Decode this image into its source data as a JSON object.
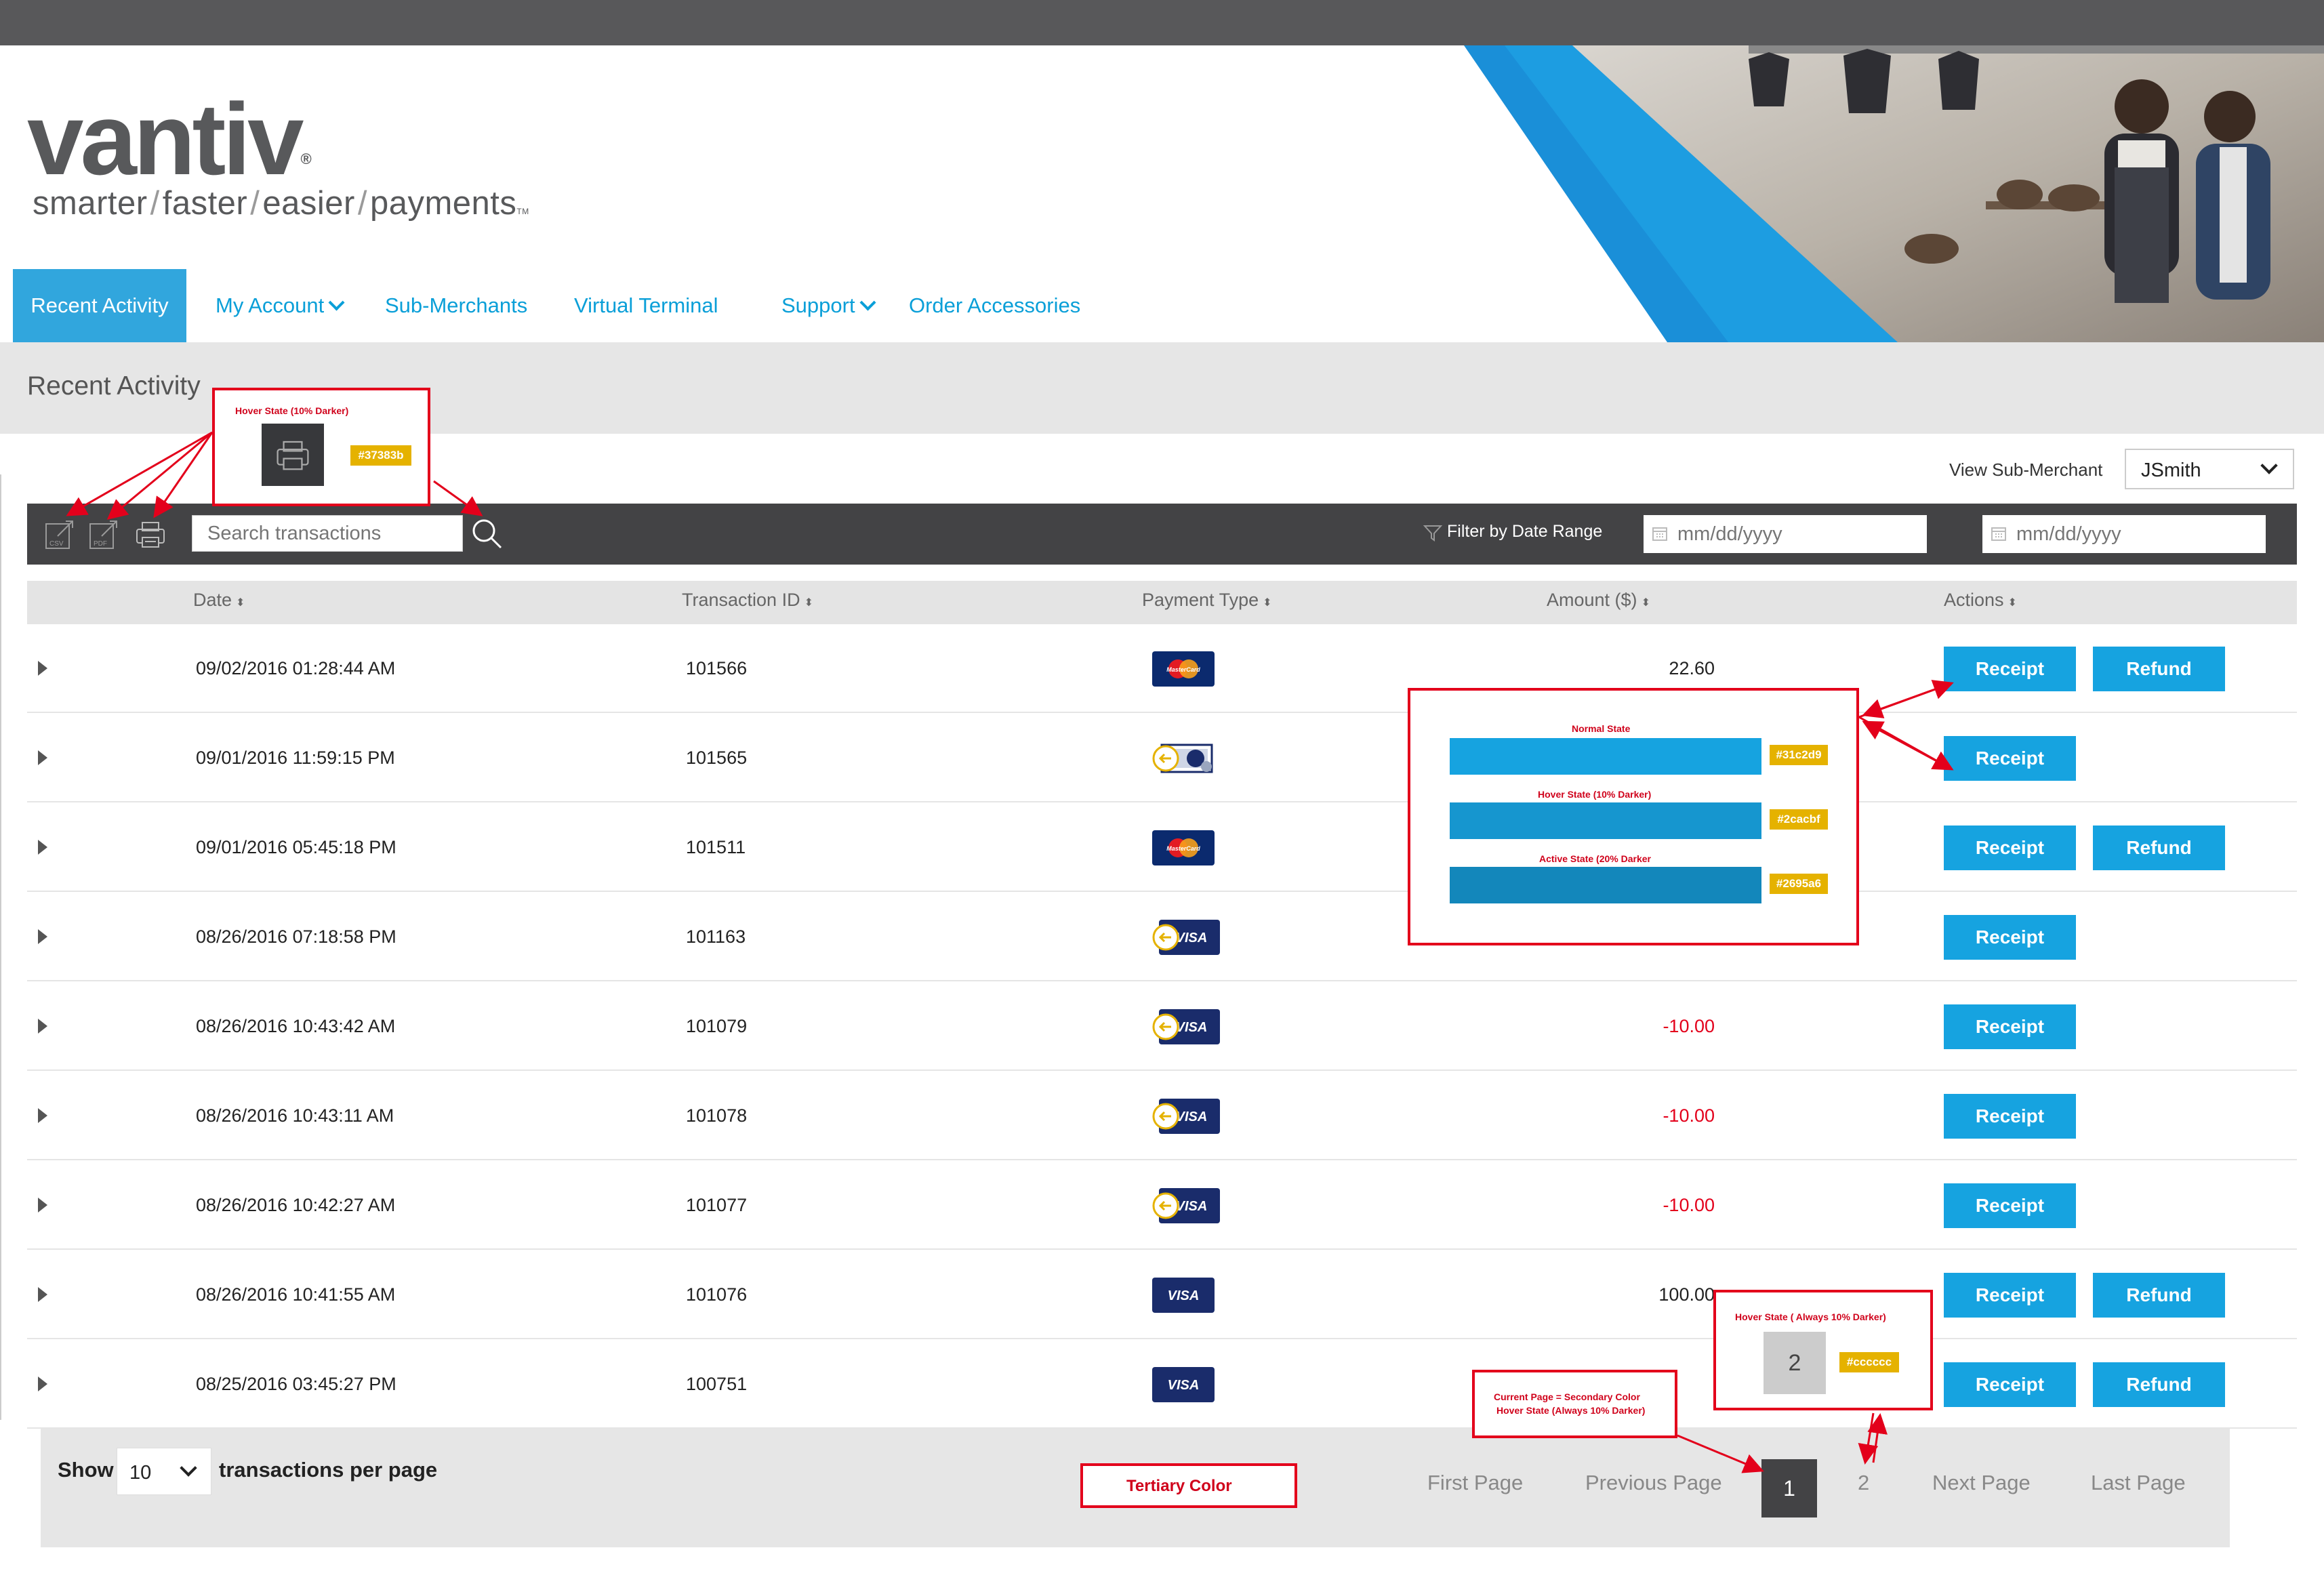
{
  "brand": {
    "logo": "vantiv",
    "tagline_parts": [
      "smarter",
      "faster",
      "easier",
      "payments"
    ],
    "tagline_separator": "/",
    "tm": "TM"
  },
  "nav": {
    "items": [
      {
        "label": "Recent Activity",
        "active": true
      },
      {
        "label": "My Account",
        "dropdown": true
      },
      {
        "label": "Sub-Merchants"
      },
      {
        "label": "Virtual Terminal"
      },
      {
        "label": "Support",
        "dropdown": true
      },
      {
        "label": "Order Accessories"
      }
    ]
  },
  "page": {
    "title": "Recent Activity"
  },
  "sub_merchant": {
    "label": "View Sub-Merchant",
    "value": "JSmith"
  },
  "toolbar": {
    "export_icons": [
      "csv-icon",
      "pdf-icon",
      "print-icon"
    ],
    "csv_label": "CSV",
    "pdf_label": "PDF",
    "search_placeholder": "Search transactions",
    "filter_label": "Filter by Date Range",
    "date_placeholder": "mm/dd/yyyy"
  },
  "table": {
    "columns": [
      "Date",
      "Transaction ID",
      "Payment Type",
      "Amount ($)",
      "Actions"
    ],
    "sort_glyph": "⬍",
    "receipt_label": "Receipt",
    "refund_label": "Refund",
    "rows": [
      {
        "date": "09/02/2016 01:28:44 AM",
        "id": "101566",
        "payment": "mastercard",
        "amount": "22.60",
        "negative": false,
        "refund": true
      },
      {
        "date": "09/01/2016 11:59:15 PM",
        "id": "101565",
        "payment": "check",
        "amount": "",
        "negative": false,
        "refund": false
      },
      {
        "date": "09/01/2016 05:45:18 PM",
        "id": "101511",
        "payment": "mastercard",
        "amount": "",
        "negative": false,
        "refund": true
      },
      {
        "date": "08/26/2016 07:18:58 PM",
        "id": "101163",
        "payment": "visa-return",
        "amount": "",
        "negative": false,
        "refund": false
      },
      {
        "date": "08/26/2016 10:43:42 AM",
        "id": "101079",
        "payment": "visa-return",
        "amount": "-10.00",
        "negative": true,
        "refund": false
      },
      {
        "date": "08/26/2016 10:43:11 AM",
        "id": "101078",
        "payment": "visa-return",
        "amount": "-10.00",
        "negative": true,
        "refund": false
      },
      {
        "date": "08/26/2016 10:42:27 AM",
        "id": "101077",
        "payment": "visa-return",
        "amount": "-10.00",
        "negative": true,
        "refund": false
      },
      {
        "date": "08/26/2016 10:41:55 AM",
        "id": "101076",
        "payment": "visa",
        "amount": "100.00",
        "negative": false,
        "refund": true
      },
      {
        "date": "08/25/2016 03:45:27 PM",
        "id": "100751",
        "payment": "visa",
        "amount": "",
        "negative": false,
        "refund": true
      }
    ],
    "card_labels": {
      "mastercard": "MasterCard",
      "visa": "VISA"
    }
  },
  "pagination": {
    "show_label": "Show",
    "per_page": "10",
    "per_page_suffix": "transactions per page",
    "first": "First Page",
    "previous": "Previous Page",
    "pages": [
      "1",
      "2"
    ],
    "current": "1",
    "next": "Next Page",
    "last": "Last Page"
  },
  "annotations": {
    "print_hover": {
      "title": "Hover State (10% Darker)",
      "color": "#37383b"
    },
    "button_states": {
      "normal": {
        "title": "Normal State",
        "color": "#31c2d9"
      },
      "hover": {
        "title": "Hover State (10% Darker)",
        "color": "#2cacbf"
      },
      "active": {
        "title": "Active State (20% Darker",
        "color": "#2695a6"
      }
    },
    "page_hover": {
      "title": "Hover State ( Always 10% Darker)",
      "sample": "2",
      "color": "#cccccc"
    },
    "current_page": {
      "line1": "Current Page = Secondary Color",
      "line2": "Hover State (Always 10% Darker)"
    },
    "tertiary": "Tertiary Color"
  },
  "colors": {
    "accent": "#16a3e0",
    "dark_toolbar": "#434345",
    "nav_text": "#0a9fd8",
    "negative": "#e3001b",
    "annotation": "#e3001b",
    "swatch_tag": "#e5b200"
  }
}
